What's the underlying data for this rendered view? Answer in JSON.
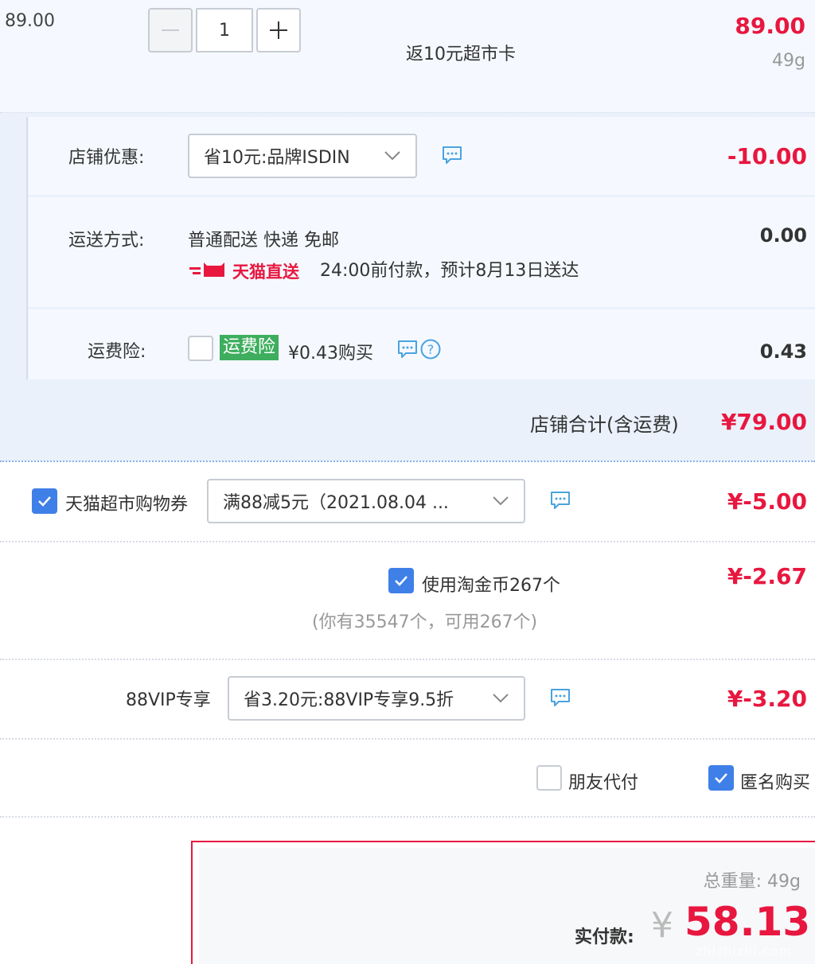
{
  "product": {
    "unit_price": "89.00",
    "quantity": "1",
    "rebate": "返10元超市卡",
    "total": "89.00",
    "weight": "49g"
  },
  "shop": {
    "discount_label": "店铺优惠:",
    "discount_selected": "省10元:品牌ISDIN",
    "discount_amount": "-10.00",
    "shipping_label": "运送方式:",
    "shipping_method": "普通配送 快递 免邮",
    "shipping_badge": "天猫直送",
    "shipping_eta": "24:00前付款，预计8月13日送达",
    "shipping_amount": "0.00",
    "insurance_label": "运费险:",
    "insurance_tag": "运费险",
    "insurance_price": "¥0.43购买",
    "insurance_amount": "0.43",
    "total_label": "店铺合计(含运费)",
    "total_value": "¥79.00"
  },
  "coupon": {
    "label": "天猫超市购物券",
    "selected": "满88减5元（2021.08.04 ...",
    "amount": "¥-5.00"
  },
  "coins": {
    "label": "使用淘金币267个",
    "note": "(你有35547个，可用267个)",
    "amount": "¥-2.67"
  },
  "vip": {
    "label": "88VIP专享",
    "selected": "省3.20元:88VIP专享9.5折",
    "amount": "¥-3.20"
  },
  "options": {
    "friend_pay": "朋友代付",
    "anonymous": "匿名购买"
  },
  "payment": {
    "weight_label": "总重量:  49g",
    "paid_label": "实付款:",
    "currency": "¥",
    "paid_value": "58.13",
    "watermark_url": "zhizhizhi.com"
  },
  "colors": {
    "accent_red": "#e8173f",
    "checkbox_blue": "#3f7fe8",
    "insurance_green": "#3eae5e",
    "band_blue": "#eaf1fb"
  },
  "icons": [
    "minus-icon",
    "plus-icon",
    "chevron-down-icon",
    "chat-bubble-icon",
    "help-circle-icon",
    "check-icon",
    "tmall-cat-icon"
  ]
}
